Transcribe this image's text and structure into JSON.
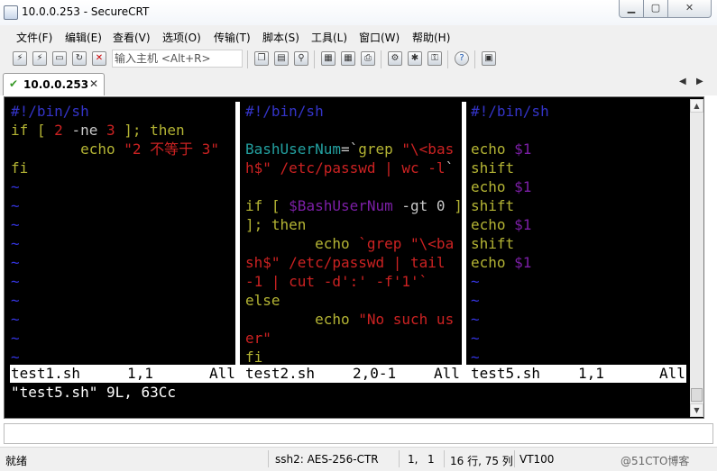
{
  "window": {
    "title": "10.0.0.253 - SecureCRT"
  },
  "menu": [
    "文件(F)",
    "编辑(E)",
    "查看(V)",
    "选项(O)",
    "传输(T)",
    "脚本(S)",
    "工具(L)",
    "窗口(W)",
    "帮助(H)"
  ],
  "toolbar": {
    "quick_connect_placeholder": "输入主机 <Alt+R>"
  },
  "tab": {
    "label": "10.0.0.253"
  },
  "panes": [
    {
      "lines": [
        [
          [
            "#!/bin/sh",
            "comment"
          ]
        ],
        [
          [
            "if [ ",
            "kw"
          ],
          [
            "2",
            "num"
          ],
          [
            " -ne ",
            "text"
          ],
          [
            "3",
            "num"
          ],
          [
            " ]; then",
            "kw"
          ]
        ],
        [
          [
            "        echo ",
            "kw"
          ],
          [
            "\"2 不等于 3\"",
            "str"
          ]
        ],
        [
          [
            "fi",
            "kw"
          ]
        ],
        [
          [
            "~",
            "tilde"
          ]
        ],
        [
          [
            "~",
            "tilde"
          ]
        ],
        [
          [
            "~",
            "tilde"
          ]
        ],
        [
          [
            "~",
            "tilde"
          ]
        ],
        [
          [
            "~",
            "tilde"
          ]
        ],
        [
          [
            "~",
            "tilde"
          ]
        ],
        [
          [
            "~",
            "tilde"
          ]
        ],
        [
          [
            "~",
            "tilde"
          ]
        ],
        [
          [
            "~",
            "tilde"
          ]
        ],
        [
          [
            "~",
            "tilde"
          ]
        ]
      ],
      "status": {
        "file": "test1.sh",
        "pos": "1,1",
        "pct": "All"
      }
    },
    {
      "lines": [
        [
          [
            "#!/bin/sh",
            "comment"
          ]
        ],
        [
          [
            "",
            "text"
          ]
        ],
        [
          [
            "BashUserNum",
            "id"
          ],
          [
            "=`",
            "op"
          ],
          [
            "grep ",
            "kw"
          ],
          [
            "\"\\<bas",
            "str"
          ]
        ],
        [
          [
            "h$\" /etc/passwd | wc -l",
            "str"
          ],
          [
            "`",
            "op"
          ]
        ],
        [
          [
            "",
            "text"
          ]
        ],
        [
          [
            "if [ ",
            "kw"
          ],
          [
            "$BashUserNum",
            "var"
          ],
          [
            " -gt 0 ",
            "text"
          ],
          [
            "]",
            "kw"
          ]
        ],
        [
          [
            "]; then",
            "kw"
          ]
        ],
        [
          [
            "        echo ",
            "kw"
          ],
          [
            "`grep \"\\<ba",
            "str"
          ]
        ],
        [
          [
            "sh$\" /etc/passwd | tail ",
            "str"
          ]
        ],
        [
          [
            "-1 | cut -d':' -f'1'`",
            "str"
          ]
        ],
        [
          [
            "else",
            "kw"
          ]
        ],
        [
          [
            "        echo ",
            "kw"
          ],
          [
            "\"No such us",
            "str"
          ]
        ],
        [
          [
            "er\"",
            "str"
          ]
        ],
        [
          [
            "fi",
            "kw"
          ]
        ]
      ],
      "status": {
        "file": "test2.sh",
        "pos": "2,0-1",
        "pct": "All"
      }
    },
    {
      "lines": [
        [
          [
            "#!/bin/sh",
            "comment"
          ]
        ],
        [
          [
            "",
            "text"
          ]
        ],
        [
          [
            "echo ",
            "kw"
          ],
          [
            "$1",
            "var"
          ]
        ],
        [
          [
            "shift",
            "kw"
          ]
        ],
        [
          [
            "echo ",
            "kw"
          ],
          [
            "$1",
            "var"
          ]
        ],
        [
          [
            "shift",
            "kw"
          ]
        ],
        [
          [
            "echo ",
            "kw"
          ],
          [
            "$1",
            "var"
          ]
        ],
        [
          [
            "shift",
            "kw"
          ]
        ],
        [
          [
            "echo ",
            "kw"
          ],
          [
            "$1",
            "var"
          ]
        ],
        [
          [
            "~",
            "tilde"
          ]
        ],
        [
          [
            "~",
            "tilde"
          ]
        ],
        [
          [
            "~",
            "tilde"
          ]
        ],
        [
          [
            "~",
            "tilde"
          ]
        ],
        [
          [
            "~",
            "tilde"
          ]
        ]
      ],
      "status": {
        "file": "test5.sh",
        "pos": "1,1",
        "pct": "All"
      }
    }
  ],
  "command_line": "\"test5.sh\" 9L, 63Cc",
  "statusbar": {
    "ready": "就绪",
    "cipher": "ssh2: AES-256-CTR",
    "cursor_row": "1,",
    "cursor_col": "1",
    "size": "16 行, 75 列",
    "emulation": "VT100",
    "watermark": "@51CTO博客"
  },
  "colors": {
    "terminal_bg": "#000000",
    "comment": "#3434c8",
    "keyword": "#b4b434",
    "string": "#cc2222",
    "variable": "#7c1fa6"
  }
}
